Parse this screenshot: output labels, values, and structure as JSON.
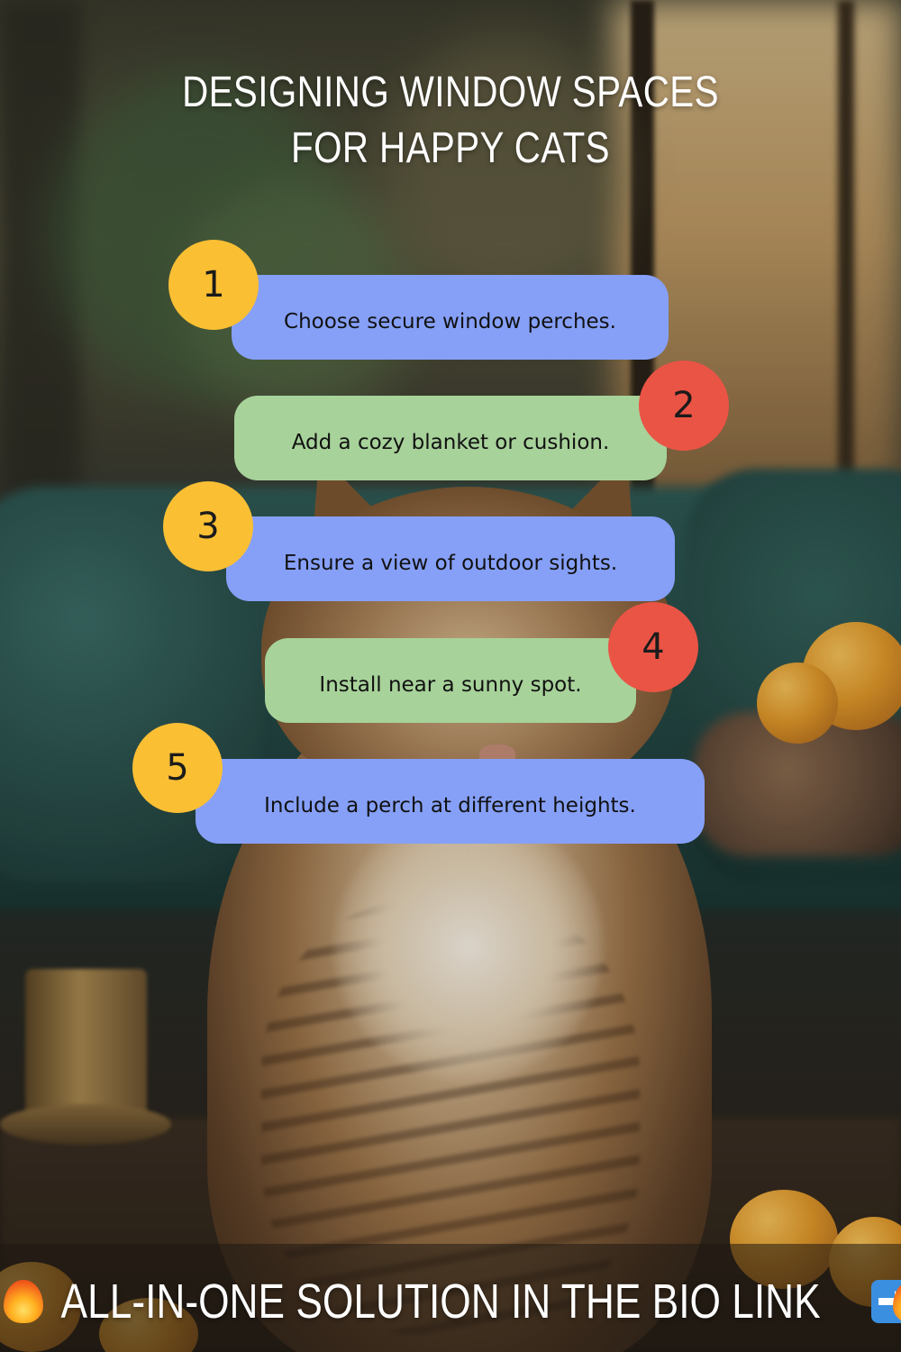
{
  "title": "DESIGNING WINDOW SPACES FOR HAPPY CATS",
  "steps": [
    {
      "number": "1",
      "text": "Choose secure window perches.",
      "pill_color": "#86a0f8",
      "badge_color": "#fbbf34"
    },
    {
      "number": "2",
      "text": "Add a cozy blanket or cushion.",
      "pill_color": "#a7d29a",
      "badge_color": "#ea5445"
    },
    {
      "number": "3",
      "text": "Ensure a view of outdoor sights.",
      "pill_color": "#86a0f8",
      "badge_color": "#fbbf34"
    },
    {
      "number": "4",
      "text": "Install near a sunny spot.",
      "pill_color": "#a7d29a",
      "badge_color": "#ea5445"
    },
    {
      "number": "5",
      "text": "Include a perch at different heights.",
      "pill_color": "#86a0f8",
      "badge_color": "#fbbf34"
    }
  ],
  "cta": {
    "text": "ALL-IN-ONE SOLUTION IN THE BIO LINK",
    "icons": [
      "fire-icon",
      "right-arrow-icon",
      "fire-icon"
    ]
  },
  "background": "blurred photo of a fluffy tabby cat with eyes closed on a teal sofa by a window, oranges on the table"
}
